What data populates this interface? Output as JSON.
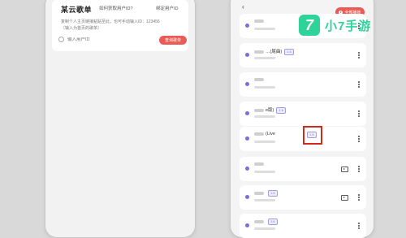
{
  "left": {
    "title": "某云歌单",
    "help_link": "如何获取用户ID?",
    "bind_link": "绑定用户ID",
    "description": "复制个人主页链接粘贴至此，也可手动输入ID：123456（输入为首页的歌单）",
    "uid_placeholder": "输入用户ID",
    "query_button": "查询歌单"
  },
  "right": {
    "back_label": "‹",
    "play_all_label": "全部播放",
    "songs": [
      {
        "title": "",
        "tag": ""
      },
      {
        "title": "…(尾曲)",
        "tag": "1.6"
      },
      {
        "title": "",
        "tag": ""
      },
      {
        "title": "e版)",
        "tag": "1.6"
      },
      {
        "title": "(Live",
        "tag": "1.6"
      },
      {
        "title": "",
        "tag": ""
      },
      {
        "title": "",
        "tag": "1.6"
      },
      {
        "title": "",
        "tag": "1.6"
      }
    ],
    "highlight_tag": "1.6"
  },
  "logo": {
    "mark": "7",
    "text": "小7手游",
    "color": "#2ed39a"
  },
  "colors": {
    "accent": "#ea5b55",
    "highlight": "#d02a1c"
  }
}
